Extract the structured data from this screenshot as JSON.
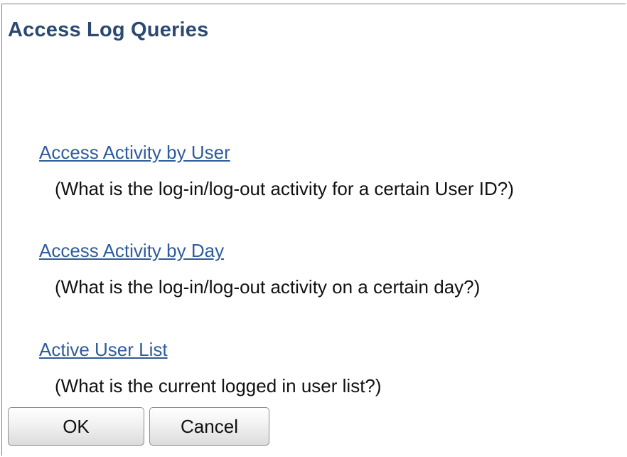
{
  "page": {
    "title": "Access Log Queries"
  },
  "queries": [
    {
      "link": "Access Activity by User",
      "description": "(What is the log-in/log-out activity for a certain User ID?)"
    },
    {
      "link": "Access Activity by Day",
      "description": "(What is the log-in/log-out activity on a certain day?)"
    },
    {
      "link": "Active User List",
      "description": "(What is the current logged in user list?)"
    }
  ],
  "buttons": {
    "ok_label": "OK",
    "cancel_label": "Cancel"
  },
  "colors": {
    "title": "#2b4a72",
    "link": "#2e5c9c"
  }
}
